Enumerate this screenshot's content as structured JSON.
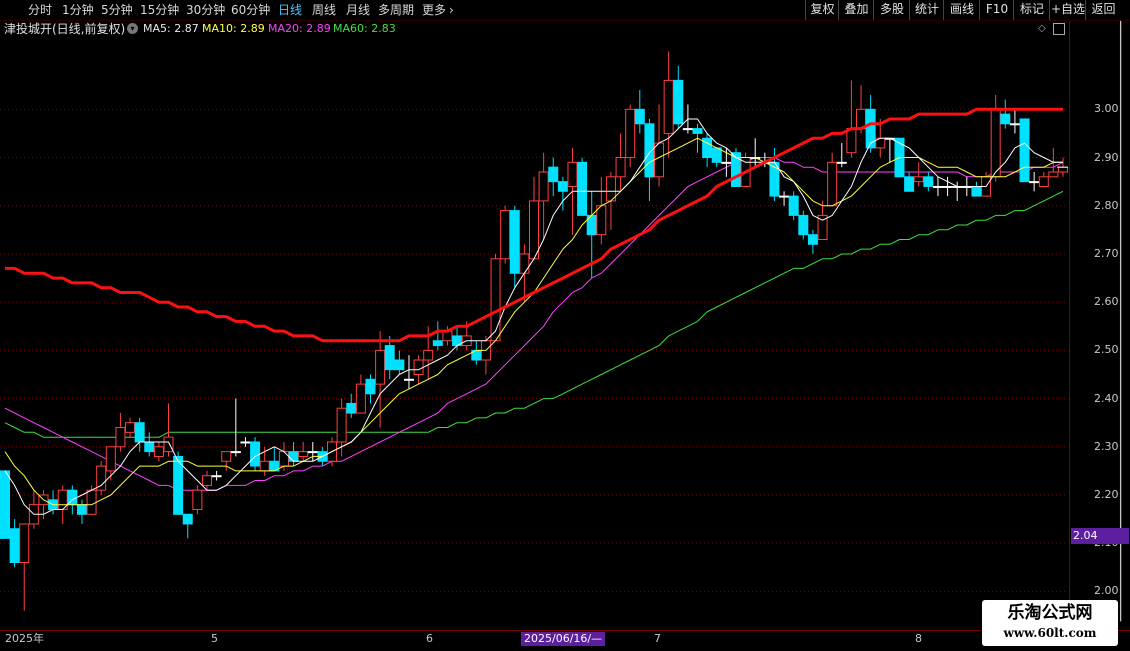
{
  "toolbar": {
    "periods": [
      "分时",
      "1分钟",
      "5分钟",
      "15分钟",
      "30分钟",
      "60分钟",
      "日线",
      "周线",
      "月线",
      "多周期",
      "更多"
    ],
    "active_period": "日线",
    "buttons": [
      "复权",
      "叠加",
      "多股",
      "统计",
      "画线",
      "F10",
      "标记",
      "+自选",
      "返回"
    ]
  },
  "info": {
    "title": "津投城开(日线,前复权)",
    "ma5": "MA5: 2.87",
    "ma10": "MA10: 2.89",
    "ma20": "MA20: 2.89",
    "ma60": "MA60: 2.83"
  },
  "colors": {
    "up": "#ff4040",
    "down": "#00e0ff",
    "ma5": "#ffffff",
    "ma10": "#ffff40",
    "ma20": "#ff40ff",
    "ma60": "#40e040",
    "ma_thick": "#ff1010",
    "grid": "#7a0000"
  },
  "yaxis": {
    "ticks": [
      "3.00",
      "2.90",
      "2.80",
      "2.70",
      "2.60",
      "2.50",
      "2.40",
      "2.30",
      "2.20",
      "2.10",
      "2.00"
    ],
    "price_tag": "2.04"
  },
  "xaxis": {
    "labels": [
      "2025年",
      "5",
      "6",
      "7",
      "8"
    ],
    "cross_date": "2025/06/16/—"
  },
  "watermark": {
    "line1": "乐淘公式网",
    "line2": "www.60lt.com"
  },
  "chart_data": {
    "type": "candlestick",
    "ylim": [
      1.92,
      3.15
    ],
    "ticks": [
      3.0,
      2.9,
      2.8,
      2.7,
      2.6,
      2.5,
      2.4,
      2.3,
      2.2,
      2.1,
      2.0
    ],
    "candles": [
      [
        2.25,
        2.11,
        2.25,
        2.11
      ],
      [
        2.13,
        2.06,
        2.15,
        2.05
      ],
      [
        2.06,
        2.14,
        2.14,
        1.96
      ],
      [
        2.14,
        2.18,
        2.21,
        2.13
      ],
      [
        2.18,
        2.2,
        2.21,
        2.15
      ],
      [
        2.19,
        2.17,
        2.21,
        2.16
      ],
      [
        2.17,
        2.21,
        2.22,
        2.14
      ],
      [
        2.21,
        2.18,
        2.22,
        2.16
      ],
      [
        2.18,
        2.16,
        2.19,
        2.14
      ],
      [
        2.16,
        2.21,
        2.22,
        2.16
      ],
      [
        2.21,
        2.26,
        2.27,
        2.2
      ],
      [
        2.25,
        2.3,
        2.3,
        2.23
      ],
      [
        2.3,
        2.34,
        2.37,
        2.29
      ],
      [
        2.33,
        2.35,
        2.36,
        2.32
      ],
      [
        2.35,
        2.31,
        2.36,
        2.29
      ],
      [
        2.31,
        2.29,
        2.33,
        2.28
      ],
      [
        2.28,
        2.3,
        2.31,
        2.27
      ],
      [
        2.29,
        2.32,
        2.39,
        2.28
      ],
      [
        2.28,
        2.16,
        2.29,
        2.16
      ],
      [
        2.16,
        2.14,
        2.15,
        2.11
      ],
      [
        2.17,
        2.21,
        2.22,
        2.16
      ],
      [
        2.22,
        2.24,
        2.25,
        2.21
      ],
      [
        2.24,
        2.24,
        2.25,
        2.23
      ],
      [
        2.27,
        2.29,
        2.29,
        2.25
      ],
      [
        2.29,
        2.29,
        2.4,
        2.28
      ],
      [
        2.31,
        2.31,
        2.32,
        2.3
      ],
      [
        2.31,
        2.26,
        2.32,
        2.25
      ],
      [
        2.25,
        2.27,
        2.3,
        2.24
      ],
      [
        2.27,
        2.25,
        2.3,
        2.25
      ],
      [
        2.26,
        2.29,
        2.31,
        2.25
      ],
      [
        2.29,
        2.27,
        2.31,
        2.26
      ],
      [
        2.28,
        2.29,
        2.31,
        2.27
      ],
      [
        2.29,
        2.29,
        2.31,
        2.27
      ],
      [
        2.29,
        2.27,
        2.3,
        2.26
      ],
      [
        2.27,
        2.31,
        2.32,
        2.26
      ],
      [
        2.31,
        2.38,
        2.4,
        2.28
      ],
      [
        2.39,
        2.37,
        2.41,
        2.36
      ],
      [
        2.37,
        2.43,
        2.45,
        2.37
      ],
      [
        2.44,
        2.41,
        2.45,
        2.39
      ],
      [
        2.43,
        2.5,
        2.54,
        2.34
      ],
      [
        2.51,
        2.46,
        2.53,
        2.44
      ],
      [
        2.48,
        2.46,
        2.5,
        2.45
      ],
      [
        2.44,
        2.44,
        2.49,
        2.42
      ],
      [
        2.45,
        2.48,
        2.49,
        2.43
      ],
      [
        2.48,
        2.5,
        2.55,
        2.44
      ],
      [
        2.52,
        2.51,
        2.56,
        2.5
      ],
      [
        2.52,
        2.54,
        2.55,
        2.51
      ],
      [
        2.53,
        2.51,
        2.55,
        2.5
      ],
      [
        2.51,
        2.53,
        2.56,
        2.5
      ],
      [
        2.5,
        2.48,
        2.52,
        2.47
      ],
      [
        2.48,
        2.52,
        2.53,
        2.45
      ],
      [
        2.52,
        2.69,
        2.7,
        2.52
      ],
      [
        2.69,
        2.79,
        2.8,
        2.68
      ],
      [
        2.79,
        2.66,
        2.8,
        2.63
      ],
      [
        2.66,
        2.7,
        2.72,
        2.6
      ],
      [
        2.69,
        2.81,
        2.86,
        2.69
      ],
      [
        2.81,
        2.87,
        2.91,
        2.73
      ],
      [
        2.88,
        2.85,
        2.9,
        2.82
      ],
      [
        2.85,
        2.83,
        2.86,
        2.79
      ],
      [
        2.84,
        2.89,
        2.92,
        2.74
      ],
      [
        2.89,
        2.78,
        2.9,
        2.78
      ],
      [
        2.78,
        2.74,
        2.83,
        2.65
      ],
      [
        2.74,
        2.8,
        2.86,
        2.72
      ],
      [
        2.81,
        2.86,
        2.87,
        2.75
      ],
      [
        2.86,
        2.9,
        2.95,
        2.83
      ],
      [
        2.9,
        3.0,
        3.01,
        2.88
      ],
      [
        3.0,
        2.97,
        3.04,
        2.95
      ],
      [
        2.97,
        2.86,
        2.98,
        2.81
      ],
      [
        2.86,
        2.93,
        3.01,
        2.84
      ],
      [
        2.95,
        3.06,
        3.12,
        2.9
      ],
      [
        3.06,
        2.97,
        3.09,
        2.96
      ],
      [
        2.96,
        2.96,
        3.01,
        2.95
      ],
      [
        2.96,
        2.95,
        2.97,
        2.91
      ],
      [
        2.94,
        2.9,
        2.95,
        2.88
      ],
      [
        2.92,
        2.89,
        2.92,
        2.88
      ],
      [
        2.89,
        2.89,
        2.92,
        2.86
      ],
      [
        2.91,
        2.84,
        2.92,
        2.84
      ],
      [
        2.84,
        2.9,
        2.91,
        2.84
      ],
      [
        2.9,
        2.9,
        2.94,
        2.88
      ],
      [
        2.89,
        2.89,
        2.91,
        2.88
      ],
      [
        2.89,
        2.82,
        2.92,
        2.81
      ],
      [
        2.82,
        2.82,
        2.83,
        2.8
      ],
      [
        2.82,
        2.78,
        2.83,
        2.77
      ],
      [
        2.78,
        2.74,
        2.79,
        2.73
      ],
      [
        2.74,
        2.72,
        2.75,
        2.7
      ],
      [
        2.73,
        2.78,
        2.81,
        2.73
      ],
      [
        2.8,
        2.89,
        2.91,
        2.8
      ],
      [
        2.89,
        2.89,
        2.93,
        2.88
      ],
      [
        2.91,
        2.96,
        3.06,
        2.9
      ],
      [
        2.96,
        3.0,
        3.05,
        2.95
      ],
      [
        3.0,
        2.92,
        3.03,
        2.91
      ],
      [
        2.92,
        2.94,
        2.98,
        2.9
      ],
      [
        2.94,
        2.94,
        2.94,
        2.89
      ],
      [
        2.94,
        2.86,
        2.94,
        2.86
      ],
      [
        2.86,
        2.83,
        2.87,
        2.83
      ],
      [
        2.85,
        2.86,
        2.89,
        2.84
      ],
      [
        2.86,
        2.84,
        2.87,
        2.83
      ],
      [
        2.84,
        2.84,
        2.86,
        2.82
      ],
      [
        2.84,
        2.84,
        2.86,
        2.82
      ],
      [
        2.84,
        2.84,
        2.85,
        2.81
      ],
      [
        2.84,
        2.84,
        2.86,
        2.82
      ],
      [
        2.84,
        2.82,
        2.85,
        2.82
      ],
      [
        2.82,
        2.86,
        2.87,
        2.82
      ],
      [
        2.86,
        3.0,
        3.03,
        2.85
      ],
      [
        2.99,
        2.97,
        3.02,
        2.96
      ],
      [
        2.97,
        2.97,
        3.0,
        2.95
      ],
      [
        2.98,
        2.85,
        2.98,
        2.85
      ],
      [
        2.85,
        2.85,
        2.87,
        2.83
      ],
      [
        2.84,
        2.86,
        2.87,
        2.84
      ],
      [
        2.86,
        2.87,
        2.92,
        2.86
      ],
      [
        2.87,
        2.88,
        2.9,
        2.86
      ]
    ],
    "ma5": [
      2.25,
      2.22,
      2.18,
      2.16,
      2.16,
      2.17,
      2.17,
      2.19,
      2.2,
      2.21,
      2.22,
      2.24,
      2.26,
      2.29,
      2.31,
      2.31,
      2.31,
      2.31,
      2.27,
      2.25,
      2.23,
      2.21,
      2.21,
      2.22,
      2.24,
      2.26,
      2.28,
      2.29,
      2.3,
      2.29,
      2.27,
      2.27,
      2.27,
      2.28,
      2.29,
      2.3,
      2.31,
      2.33,
      2.37,
      2.41,
      2.43,
      2.45,
      2.46,
      2.46,
      2.47,
      2.48,
      2.49,
      2.51,
      2.52,
      2.52,
      2.52,
      2.54,
      2.59,
      2.63,
      2.66,
      2.69,
      2.73,
      2.78,
      2.81,
      2.83,
      2.83,
      2.83,
      2.83,
      2.83,
      2.83,
      2.85,
      2.88,
      2.91,
      2.93,
      2.94,
      2.96,
      2.98,
      2.98,
      2.95,
      2.93,
      2.92,
      2.9,
      2.89,
      2.89,
      2.89,
      2.89,
      2.86,
      2.85,
      2.82,
      2.78,
      2.77,
      2.78,
      2.81,
      2.84,
      2.89,
      2.93,
      2.94,
      2.94,
      2.93,
      2.92,
      2.9,
      2.88,
      2.86,
      2.85,
      2.84,
      2.84,
      2.84,
      2.84,
      2.87,
      2.89,
      2.92,
      2.93,
      2.91,
      2.9,
      2.89,
      2.89
    ],
    "ma10": [
      2.29,
      2.26,
      2.24,
      2.21,
      2.19,
      2.18,
      2.18,
      2.18,
      2.18,
      2.18,
      2.19,
      2.2,
      2.22,
      2.24,
      2.26,
      2.26,
      2.26,
      2.27,
      2.27,
      2.27,
      2.26,
      2.26,
      2.26,
      2.26,
      2.25,
      2.25,
      2.25,
      2.25,
      2.25,
      2.26,
      2.26,
      2.27,
      2.28,
      2.28,
      2.29,
      2.3,
      2.31,
      2.33,
      2.35,
      2.37,
      2.39,
      2.41,
      2.42,
      2.43,
      2.44,
      2.45,
      2.47,
      2.48,
      2.49,
      2.5,
      2.5,
      2.52,
      2.55,
      2.58,
      2.6,
      2.62,
      2.65,
      2.68,
      2.71,
      2.73,
      2.76,
      2.78,
      2.8,
      2.81,
      2.83,
      2.85,
      2.87,
      2.89,
      2.9,
      2.91,
      2.92,
      2.93,
      2.94,
      2.93,
      2.92,
      2.91,
      2.9,
      2.9,
      2.9,
      2.89,
      2.88,
      2.87,
      2.85,
      2.83,
      2.81,
      2.8,
      2.8,
      2.81,
      2.82,
      2.84,
      2.86,
      2.88,
      2.89,
      2.9,
      2.9,
      2.9,
      2.89,
      2.88,
      2.88,
      2.88,
      2.87,
      2.86,
      2.86,
      2.86,
      2.86,
      2.87,
      2.88,
      2.88,
      2.88,
      2.89,
      2.89
    ],
    "ma20": [
      2.38,
      2.37,
      2.36,
      2.35,
      2.34,
      2.33,
      2.32,
      2.31,
      2.3,
      2.29,
      2.28,
      2.27,
      2.26,
      2.25,
      2.24,
      2.23,
      2.22,
      2.22,
      2.21,
      2.21,
      2.21,
      2.21,
      2.21,
      2.22,
      2.22,
      2.22,
      2.23,
      2.23,
      2.24,
      2.24,
      2.25,
      2.25,
      2.26,
      2.26,
      2.27,
      2.27,
      2.28,
      2.29,
      2.3,
      2.31,
      2.32,
      2.33,
      2.34,
      2.35,
      2.36,
      2.37,
      2.39,
      2.4,
      2.41,
      2.42,
      2.43,
      2.45,
      2.47,
      2.49,
      2.51,
      2.53,
      2.55,
      2.58,
      2.6,
      2.62,
      2.63,
      2.65,
      2.66,
      2.68,
      2.7,
      2.72,
      2.74,
      2.76,
      2.78,
      2.8,
      2.82,
      2.84,
      2.85,
      2.86,
      2.87,
      2.88,
      2.89,
      2.89,
      2.9,
      2.9,
      2.9,
      2.89,
      2.89,
      2.88,
      2.88,
      2.87,
      2.87,
      2.87,
      2.87,
      2.87,
      2.87,
      2.87,
      2.87,
      2.87,
      2.87,
      2.87,
      2.87,
      2.87,
      2.87,
      2.87,
      2.86,
      2.86,
      2.86,
      2.87,
      2.87,
      2.87,
      2.87,
      2.88,
      2.88,
      2.88,
      2.89
    ],
    "ma60": [
      2.35,
      2.34,
      2.33,
      2.33,
      2.32,
      2.32,
      2.32,
      2.32,
      2.32,
      2.32,
      2.32,
      2.32,
      2.32,
      2.32,
      2.32,
      2.32,
      2.32,
      2.33,
      2.33,
      2.33,
      2.33,
      2.33,
      2.33,
      2.33,
      2.33,
      2.33,
      2.33,
      2.33,
      2.33,
      2.33,
      2.33,
      2.33,
      2.33,
      2.33,
      2.33,
      2.33,
      2.33,
      2.33,
      2.33,
      2.33,
      2.33,
      2.33,
      2.33,
      2.33,
      2.33,
      2.34,
      2.34,
      2.35,
      2.35,
      2.36,
      2.36,
      2.37,
      2.37,
      2.38,
      2.38,
      2.39,
      2.4,
      2.4,
      2.41,
      2.42,
      2.43,
      2.44,
      2.45,
      2.46,
      2.47,
      2.48,
      2.49,
      2.5,
      2.51,
      2.53,
      2.54,
      2.55,
      2.56,
      2.58,
      2.59,
      2.6,
      2.61,
      2.62,
      2.63,
      2.64,
      2.65,
      2.66,
      2.67,
      2.67,
      2.68,
      2.69,
      2.69,
      2.7,
      2.7,
      2.71,
      2.71,
      2.72,
      2.72,
      2.73,
      2.73,
      2.74,
      2.74,
      2.75,
      2.75,
      2.76,
      2.76,
      2.77,
      2.77,
      2.78,
      2.78,
      2.79,
      2.79,
      2.8,
      2.81,
      2.82,
      2.83
    ],
    "ma_thick": [
      2.67,
      2.67,
      2.66,
      2.66,
      2.66,
      2.65,
      2.65,
      2.64,
      2.64,
      2.64,
      2.63,
      2.63,
      2.62,
      2.62,
      2.62,
      2.61,
      2.6,
      2.6,
      2.59,
      2.59,
      2.58,
      2.58,
      2.57,
      2.57,
      2.56,
      2.56,
      2.55,
      2.55,
      2.54,
      2.54,
      2.53,
      2.53,
      2.53,
      2.52,
      2.52,
      2.52,
      2.52,
      2.52,
      2.52,
      2.52,
      2.52,
      2.52,
      2.53,
      2.53,
      2.53,
      2.54,
      2.54,
      2.55,
      2.55,
      2.56,
      2.57,
      2.58,
      2.59,
      2.6,
      2.61,
      2.62,
      2.63,
      2.64,
      2.65,
      2.66,
      2.67,
      2.68,
      2.69,
      2.71,
      2.72,
      2.73,
      2.74,
      2.75,
      2.77,
      2.78,
      2.79,
      2.8,
      2.81,
      2.82,
      2.84,
      2.85,
      2.86,
      2.87,
      2.88,
      2.89,
      2.9,
      2.91,
      2.92,
      2.93,
      2.94,
      2.94,
      2.95,
      2.95,
      2.96,
      2.96,
      2.97,
      2.97,
      2.98,
      2.98,
      2.98,
      2.99,
      2.99,
      2.99,
      2.99,
      2.99,
      2.99,
      3.0,
      3.0,
      3.0,
      3.0,
      3.0,
      3.0,
      3.0,
      3.0,
      3.0,
      3.0
    ]
  }
}
